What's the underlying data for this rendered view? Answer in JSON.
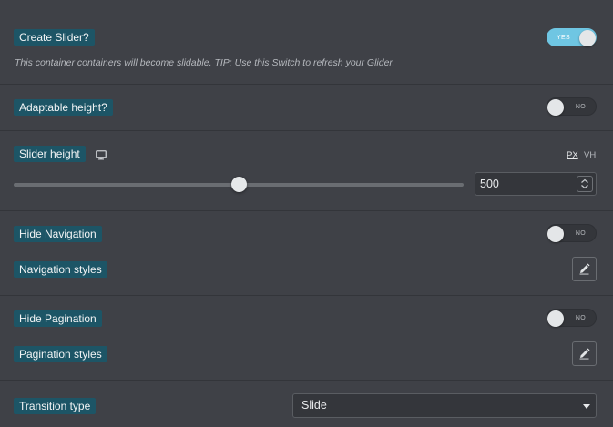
{
  "create_slider": {
    "label": "Create Slider?",
    "toggle": "YES",
    "description": "This container containers will become slidable. TIP: Use this Switch to refresh your Glider."
  },
  "adaptable_height": {
    "label": "Adaptable height?",
    "toggle": "NO"
  },
  "slider_height": {
    "label": "Slider height",
    "device_icon": "desktop-icon",
    "units": [
      "PX",
      "VH"
    ],
    "active_unit": "PX",
    "value": "500",
    "slider_fraction": 0.5
  },
  "hide_navigation": {
    "label": "Hide Navigation",
    "toggle": "NO"
  },
  "navigation_styles": {
    "label": "Navigation styles",
    "edit_icon": "pencil-icon"
  },
  "hide_pagination": {
    "label": "Hide Pagination",
    "toggle": "NO"
  },
  "pagination_styles": {
    "label": "Pagination styles",
    "edit_icon": "pencil-icon"
  },
  "transition_type": {
    "label": "Transition type",
    "value": "Slide"
  },
  "colors": {
    "panel_bg": "#3f4147",
    "label_bg": "#1d5566",
    "switch_on": "#6fc6e3"
  }
}
